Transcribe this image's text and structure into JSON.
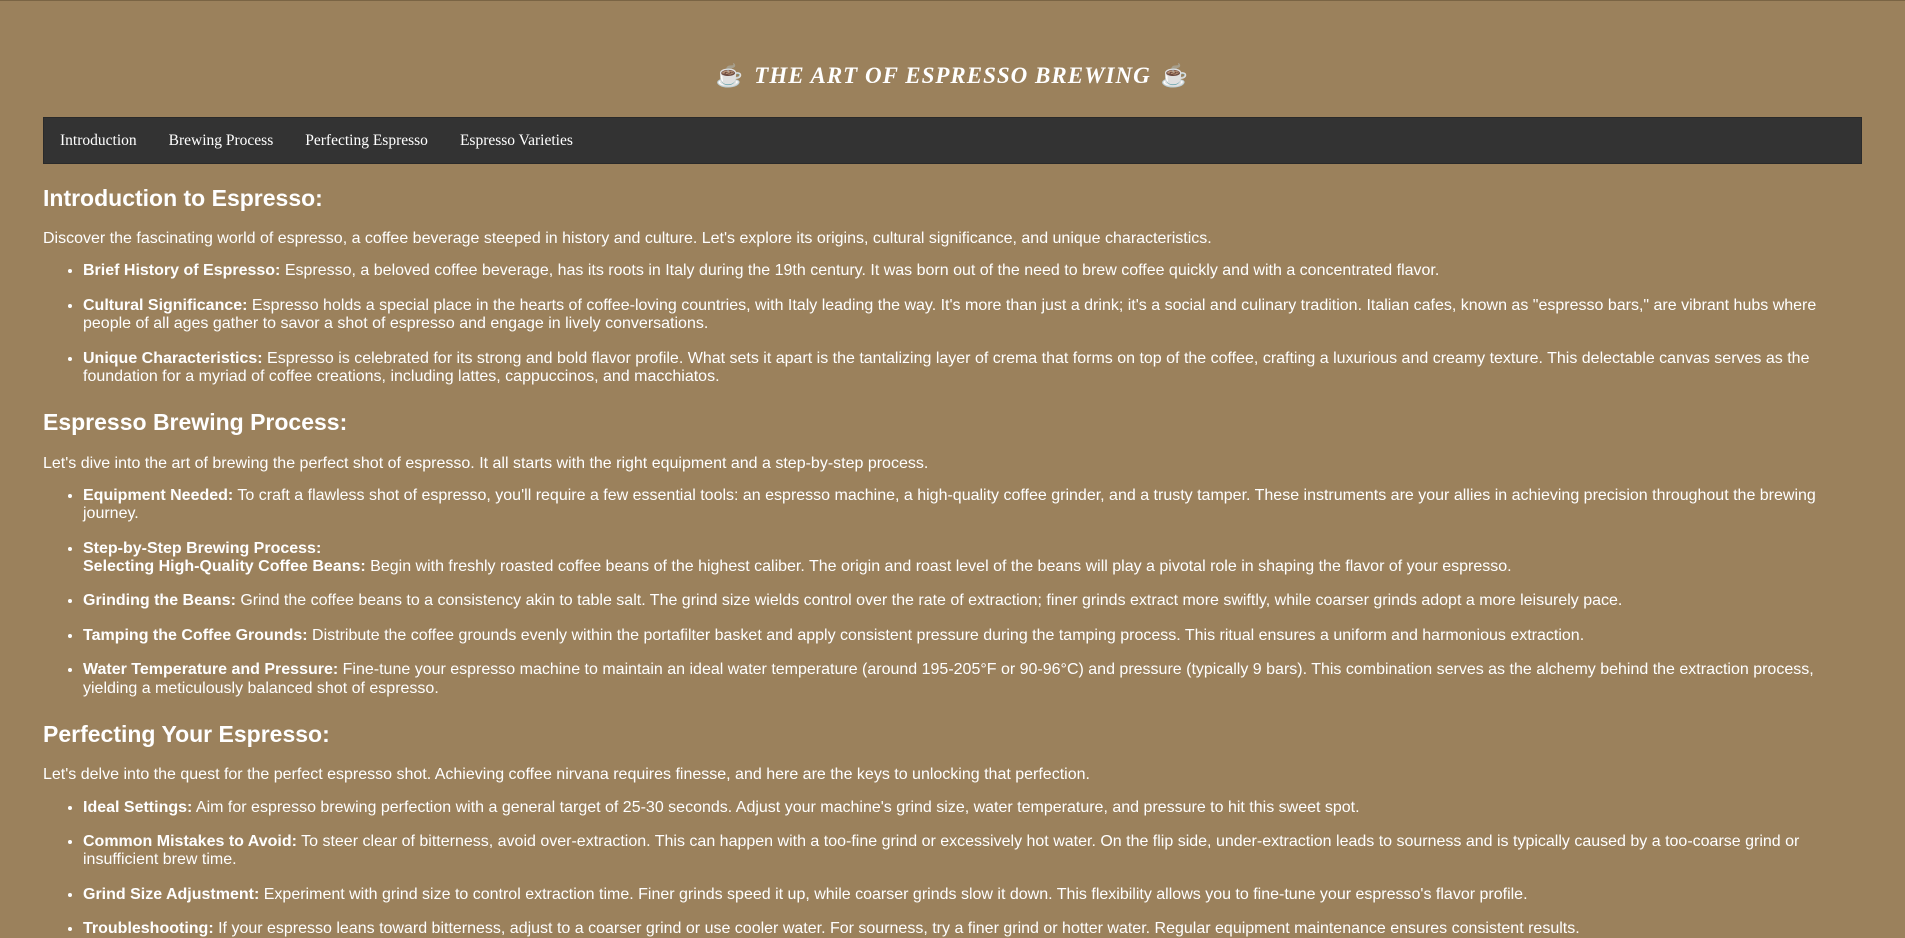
{
  "site": {
    "title": "THE ART OF ESPRESSO BREWING",
    "title_icon": "☕"
  },
  "nav": [
    {
      "label": "Introduction"
    },
    {
      "label": "Brewing Process"
    },
    {
      "label": "Perfecting Espresso"
    },
    {
      "label": "Espresso Varieties"
    }
  ],
  "sections": [
    {
      "heading": "Introduction to Espresso:",
      "intro": "Discover the fascinating world of espresso, a coffee beverage steeped in history and culture. Let's explore its origins, cultural significance, and unique characteristics.",
      "items": [
        {
          "term": "Brief History of Espresso:",
          "text": " Espresso, a beloved coffee beverage, has its roots in Italy during the 19th century. It was born out of the need to brew coffee quickly and with a concentrated flavor."
        },
        {
          "term": "Cultural Significance:",
          "text": " Espresso holds a special place in the hearts of coffee-loving countries, with Italy leading the way. It's more than just a drink; it's a social and culinary tradition. Italian cafes, known as \"espresso bars,\" are vibrant hubs where people of all ages gather to savor a shot of espresso and engage in lively conversations."
        },
        {
          "term": "Unique Characteristics:",
          "text": " Espresso is celebrated for its strong and bold flavor profile. What sets it apart is the tantalizing layer of crema that forms on top of the coffee, crafting a luxurious and creamy texture. This delectable canvas serves as the foundation for a myriad of coffee creations, including lattes, cappuccinos, and macchiatos."
        }
      ]
    },
    {
      "heading": "Espresso Brewing Process:",
      "intro": "Let's dive into the art of brewing the perfect shot of espresso. It all starts with the right equipment and a step-by-step process.",
      "items": [
        {
          "term": "Equipment Needed:",
          "text": " To craft a flawless shot of espresso, you'll require a few essential tools: an espresso machine, a high-quality coffee grinder, and a trusty tamper. These instruments are your allies in achieving precision throughout the brewing journey."
        },
        {
          "term": "Step-by-Step Brewing Process:",
          "subterm": "Selecting High-Quality Coffee Beans:",
          "text": " Begin with freshly roasted coffee beans of the highest caliber. The origin and roast level of the beans will play a pivotal role in shaping the flavor of your espresso."
        },
        {
          "term": "Grinding the Beans:",
          "text": " Grind the coffee beans to a consistency akin to table salt. The grind size wields control over the rate of extraction; finer grinds extract more swiftly, while coarser grinds adopt a more leisurely pace."
        },
        {
          "term": "Tamping the Coffee Grounds:",
          "text": " Distribute the coffee grounds evenly within the portafilter basket and apply consistent pressure during the tamping process. This ritual ensures a uniform and harmonious extraction."
        },
        {
          "term": "Water Temperature and Pressure:",
          "text": " Fine-tune your espresso machine to maintain an ideal water temperature (around 195-205°F or 90-96°C) and pressure (typically 9 bars). This combination serves as the alchemy behind the extraction process, yielding a meticulously balanced shot of espresso."
        }
      ]
    },
    {
      "heading": "Perfecting Your Espresso:",
      "intro": "Let's delve into the quest for the perfect espresso shot. Achieving coffee nirvana requires finesse, and here are the keys to unlocking that perfection.",
      "items": [
        {
          "term": "Ideal Settings:",
          "text": " Aim for espresso brewing perfection with a general target of 25-30 seconds. Adjust your machine's grind size, water temperature, and pressure to hit this sweet spot."
        },
        {
          "term": "Common Mistakes to Avoid:",
          "text": " To steer clear of bitterness, avoid over-extraction. This can happen with a too-fine grind or excessively hot water. On the flip side, under-extraction leads to sourness and is typically caused by a too-coarse grind or insufficient brew time."
        },
        {
          "term": "Grind Size Adjustment:",
          "text": " Experiment with grind size to control extraction time. Finer grinds speed it up, while coarser grinds slow it down. This flexibility allows you to fine-tune your espresso's flavor profile."
        },
        {
          "term": "Troubleshooting:",
          "text": " If your espresso leans toward bitterness, adjust to a coarser grind or use cooler water. For sourness, try a finer grind or hotter water. Regular equipment maintenance ensures consistent results."
        }
      ]
    }
  ]
}
